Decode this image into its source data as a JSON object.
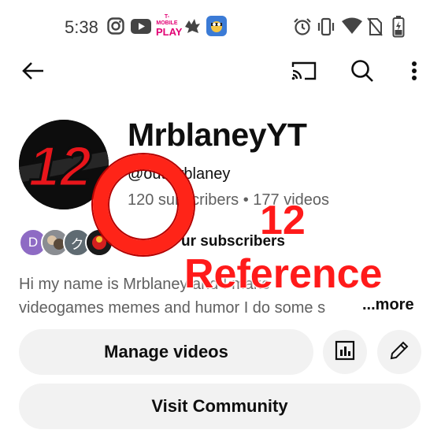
{
  "status_bar": {
    "time": "5:38",
    "play_label": "PLAY",
    "play_small": "T-MOBILE",
    "left_icons": [
      "instagram-icon",
      "youtube-icon",
      "tmobile-play-icon",
      "bird-icon",
      "game-app-icon"
    ],
    "right_icons": [
      "alarm-icon",
      "vibrate-icon",
      "wifi-icon",
      "no-sim-icon",
      "battery-charging-icon"
    ]
  },
  "app_bar": {
    "icons": [
      "back-arrow-icon",
      "cast-icon",
      "search-icon",
      "more-vert-icon"
    ]
  },
  "channel": {
    "avatar_text": "12",
    "name": "MrblaneyYT",
    "handle": "@outMrblaney",
    "stats": "120 subscribers • 177 videos",
    "subscriber_row_text": "ur subscribers",
    "sub_avatar_letters": [
      "D",
      "",
      "ク",
      ""
    ],
    "description_line1": "Hi my name is Mrblaney and I make",
    "description_line2": "videogames memes and humor  I do some s",
    "more": "...more"
  },
  "actions": {
    "manage_videos": "Manage videos",
    "visit_community": "Visit Community",
    "analytics_icon": "analytics-icon",
    "edit_icon": "edit-pencil-icon"
  },
  "overlay": {
    "number": "12",
    "reference": "Reference"
  },
  "colors": {
    "accent_red": "#ff1a1a",
    "button_bg": "#f2f2f2",
    "secondary_text": "#606060"
  }
}
